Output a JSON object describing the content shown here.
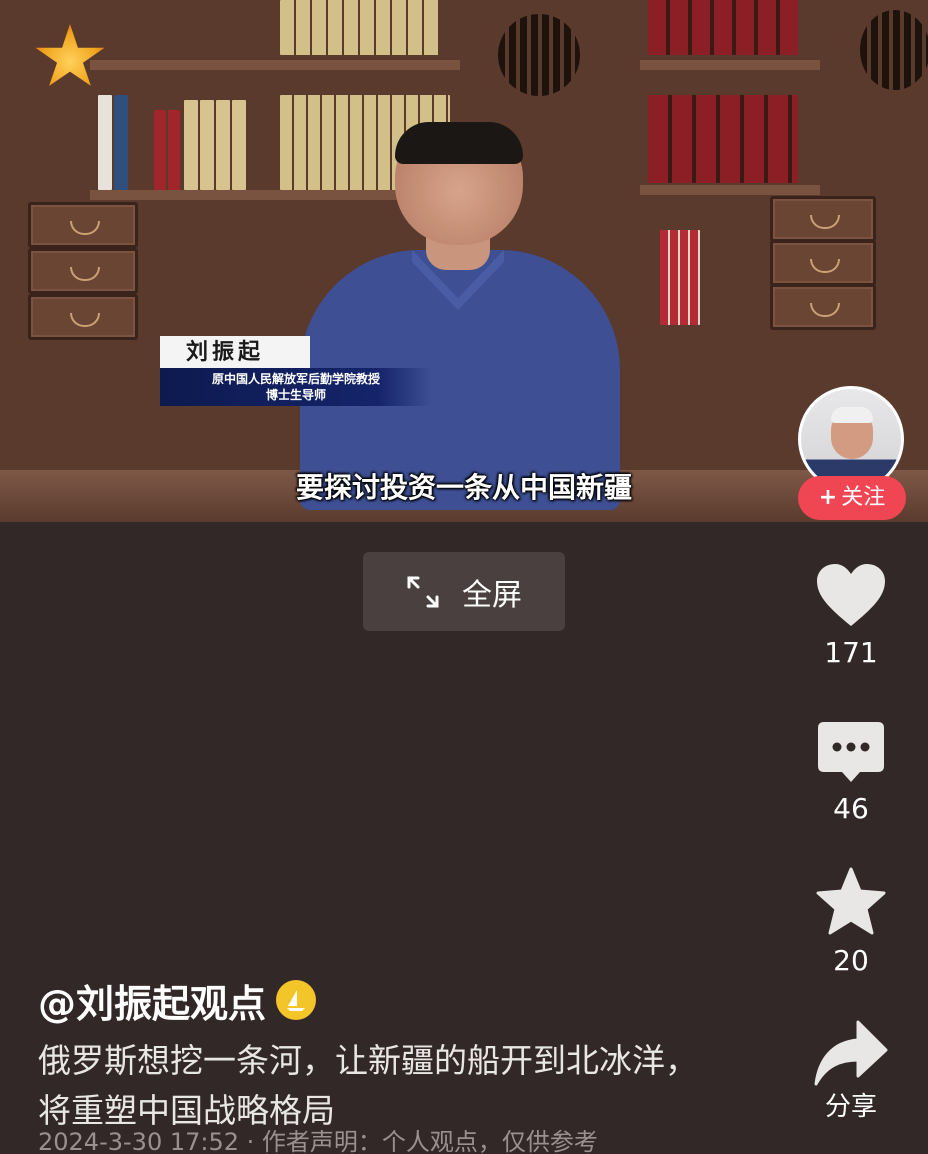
{
  "video": {
    "subtitle": "要探讨投资一条从中国新疆",
    "name_plate": "刘振起",
    "title_line1": "原中国人民解放军后勤学院教授",
    "title_line2": "博士生导师"
  },
  "follow_label": "关注",
  "fullscreen_label": "全屏",
  "actions": {
    "likes": "171",
    "comments": "46",
    "favorites": "20",
    "share_label": "分享"
  },
  "author": "@刘振起观点",
  "caption": "俄罗斯想挖一条河，让新疆的船开到北冰洋，将重塑中国战略格局",
  "meta": "2024-3-30 17:52 · 作者声明：个人观点，仅供参考",
  "colors": {
    "background": "#332828",
    "follow": "#f04552",
    "badge": "#f3c529"
  }
}
